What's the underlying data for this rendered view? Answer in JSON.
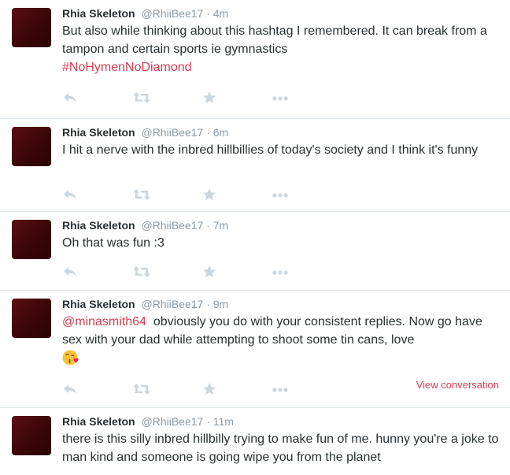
{
  "tweets": [
    {
      "fullname": "Rhia Skeleton",
      "username": "@RhiiBee17",
      "separator": "·",
      "time": "4m",
      "text": "But also while thinking about this hashtag I remembered. It can break from a tampon and certain sports ie gymnastics",
      "hashtag": "#NoHymenNoDiamond"
    },
    {
      "fullname": "Rhia Skeleton",
      "username": "@RhiiBee17",
      "separator": "·",
      "time": "6m",
      "text": "I hit a nerve with the inbred hillbillies of today's society and I think it's funny"
    },
    {
      "fullname": "Rhia Skeleton",
      "username": "@RhiiBee17",
      "separator": "·",
      "time": "7m",
      "text": "Oh that was fun :3"
    },
    {
      "fullname": "Rhia Skeleton",
      "username": "@RhiiBee17",
      "separator": "·",
      "time": "9m",
      "mention": "@minasmith64",
      "text": "obviously you do with your consistent replies. Now go have sex with your dad while attempting to shoot some tin cans, love",
      "emoji": "face-throwing-kiss",
      "view_conversation": "View conversation"
    },
    {
      "fullname": "Rhia Skeleton",
      "username": "@RhiiBee17",
      "separator": "·",
      "time": "11m",
      "text": "there is this silly inbred hillbilly trying to make fun of me. hunny you're a joke to man kind and someone is going wipe you from the planet"
    }
  ],
  "action_icons": [
    "reply-icon",
    "retweet-icon",
    "favorite-icon",
    "more-icon"
  ],
  "colors": {
    "link": "#d13f54",
    "muted": "#8899a6",
    "text": "#292f33",
    "icon": "#ccd6dd",
    "divider": "#e1e8ed",
    "avatar": "#3b0608"
  }
}
